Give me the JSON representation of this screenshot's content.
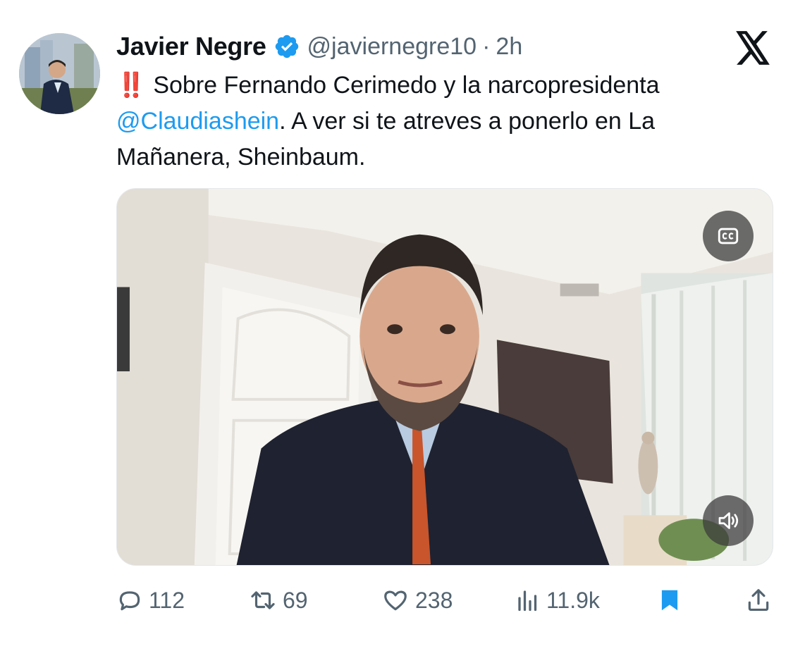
{
  "author": {
    "name": "Javier Negre",
    "handle": "@javiernegre10",
    "separator": "·",
    "time": "2h",
    "verified_icon": "verified-badge-icon",
    "verified_color": "#1d9bf0"
  },
  "platform": {
    "logo": "x-logo-icon"
  },
  "tweet": {
    "emoji": "‼️",
    "line1": "Sobre Fernando Cerimedo y la narcopresidenta",
    "mention": "@Claudiashein",
    "rest": ".  A ver si te atreves a ponerlo en La Mañanera, Sheinbaum."
  },
  "media": {
    "type": "video",
    "captions_icon": "cc-icon",
    "volume_icon": "volume-icon"
  },
  "actions": {
    "replies": "112",
    "retweets": "69",
    "likes": "238",
    "views": "11.9k",
    "reply_icon": "reply-icon",
    "retweet_icon": "retweet-icon",
    "like_icon": "heart-icon",
    "views_icon": "views-icon",
    "bookmark_icon": "bookmark-icon",
    "share_icon": "share-icon",
    "bookmark_color": "#1d9bf0"
  },
  "colors": {
    "text": "#0f1419",
    "secondary": "#536471",
    "accent": "#1d9bf0",
    "emoji_red": "#e0245e"
  }
}
